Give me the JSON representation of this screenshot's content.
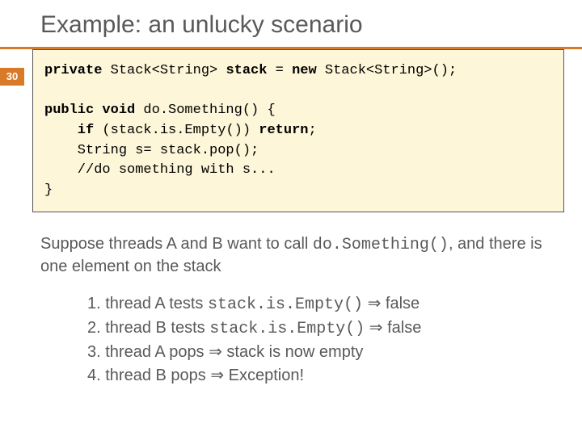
{
  "slide": {
    "number": "30",
    "title": "Example: an unlucky scenario"
  },
  "code": {
    "l1a": "private",
    "l1b": " Stack<String> ",
    "l1c": "stack",
    "l1d": " = ",
    "l1e": "new",
    "l1f": " Stack<String>();",
    "blank": "",
    "l2a": "public void",
    "l2b": " do.Something() {",
    "l3a": "    if",
    "l3b": " (stack.is.Empty()) ",
    "l3c": "return",
    "l3d": ";",
    "l4": "    String s= stack.pop();",
    "l5": "    //do something with s...",
    "l6": "}"
  },
  "body": {
    "p1a": "Suppose threads A and B want to call ",
    "p1b": "do.Something()",
    "p1c": ", and there is one element on the stack"
  },
  "steps": {
    "s1a": "1. thread A tests ",
    "s1b": "stack.is.Empty()",
    "s1c": " ⇒ false",
    "s2a": "2. thread B tests ",
    "s2b": "stack.is.Empty()",
    "s2c": " ⇒ false",
    "s3": "3. thread A pops ⇒ stack is now empty",
    "s4": "4. thread B pops ⇒ Exception!"
  }
}
